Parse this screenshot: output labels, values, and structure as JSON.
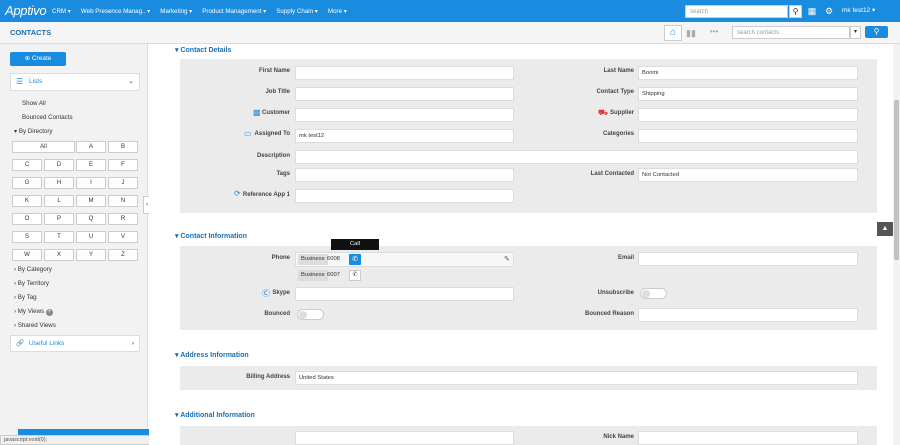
{
  "topbar": {
    "logo": "Apptivo",
    "menu": [
      "CRM ▾",
      "Web Presence Manag.. ▾",
      "Marketing ▾",
      "Product Management ▾",
      "Supply Chain ▾",
      "More ▾"
    ],
    "search_placeholder": "search",
    "user": "mk test12 ▾"
  },
  "subbar": {
    "app_title": "CONTACTS",
    "search_placeholder": "search contacts"
  },
  "sidebar": {
    "create_label": "⊕ Create",
    "lists_label": "Lists",
    "show_all": "Show All",
    "bounced": "Bounced Contacts",
    "by_directory": "By Directory",
    "letters": [
      "All",
      "A",
      "B",
      "C",
      "D",
      "E",
      "F",
      "G",
      "H",
      "I",
      "J",
      "K",
      "L",
      "M",
      "N",
      "O",
      "P",
      "Q",
      "R",
      "S",
      "T",
      "U",
      "V",
      "W",
      "X",
      "Y",
      "Z"
    ],
    "by_category": "By Category",
    "by_territory": "By Territory",
    "by_tag": "By Tag",
    "my_views": "My Views",
    "shared_views": "Shared Views",
    "useful_links": "Useful Links",
    "status": "javascript:void(0);"
  },
  "contact_details": {
    "header": "Contact Details",
    "first_name_label": "First Name",
    "first_name": "",
    "last_name_label": "Last Name",
    "last_name": "Boomi",
    "job_title_label": "Job Title",
    "contact_type_label": "Contact Type",
    "contact_type": "Shipping",
    "customer_label": "Customer",
    "supplier_label": "Supplier",
    "assigned_to_label": "Assigned To",
    "assigned_to": "mk test12",
    "categories_label": "Categories",
    "description_label": "Description",
    "tags_label": "Tags",
    "last_contacted_label": "Last Contacted",
    "last_contacted": "Not Contacted",
    "reference_label": "Reference App 1"
  },
  "contact_info": {
    "header": "Contact Information",
    "phone_label": "Phone",
    "phones": [
      {
        "type": "Business",
        "number": "6008"
      },
      {
        "type": "Business",
        "number": "6007"
      }
    ],
    "tooltip": "Call",
    "email_label": "Email",
    "skype_label": "Skype",
    "unsubscribe_label": "Unsubscribe",
    "bounced_label": "Bounced",
    "bounced_reason_label": "Bounced Reason"
  },
  "address_info": {
    "header": "Address Information",
    "billing_label": "Billing Address",
    "billing": "United States"
  },
  "additional_info": {
    "header": "Additional Information",
    "nick_name_label": "Nick Name"
  }
}
